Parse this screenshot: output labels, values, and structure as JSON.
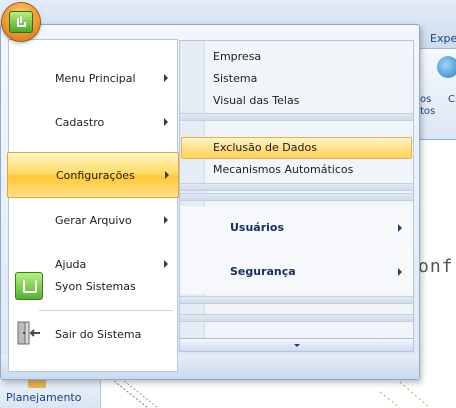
{
  "background": {
    "tab_label": "Expe",
    "ribbon_text_1": "os",
    "ribbon_text_2": "Cl",
    "ribbon_text_3": "tos",
    "conf_text": "onf",
    "left_pane_label": "Planejamento"
  },
  "menu": {
    "items": [
      {
        "label": "Menu Principal",
        "has_submenu": true
      },
      {
        "label": "Cadastro",
        "has_submenu": true
      },
      {
        "label": "Configurações",
        "has_submenu": true,
        "active": true
      },
      {
        "label": "Gerar Arquivo",
        "has_submenu": true
      },
      {
        "label": "Ajuda",
        "has_submenu": true
      },
      {
        "label": "Syon Sistemas",
        "icon": "syon-logo-icon"
      },
      {
        "label": "Sair do Sistema",
        "icon": "exit-door-icon"
      }
    ]
  },
  "submenu": {
    "items": [
      {
        "label": "Empresa"
      },
      {
        "label": "Sistema"
      },
      {
        "label": "Visual das Telas"
      },
      {
        "label": "Exclusão de Dados",
        "active": true
      },
      {
        "label": "Mecanismos Automáticos"
      }
    ],
    "groups": [
      {
        "label": "Usuários"
      },
      {
        "label": "Segurança"
      }
    ]
  },
  "colors": {
    "highlight": "#ffd35a",
    "menu_frame": "#8fa9cc",
    "group_text": "#15305c",
    "orb": "#f4a23a"
  }
}
